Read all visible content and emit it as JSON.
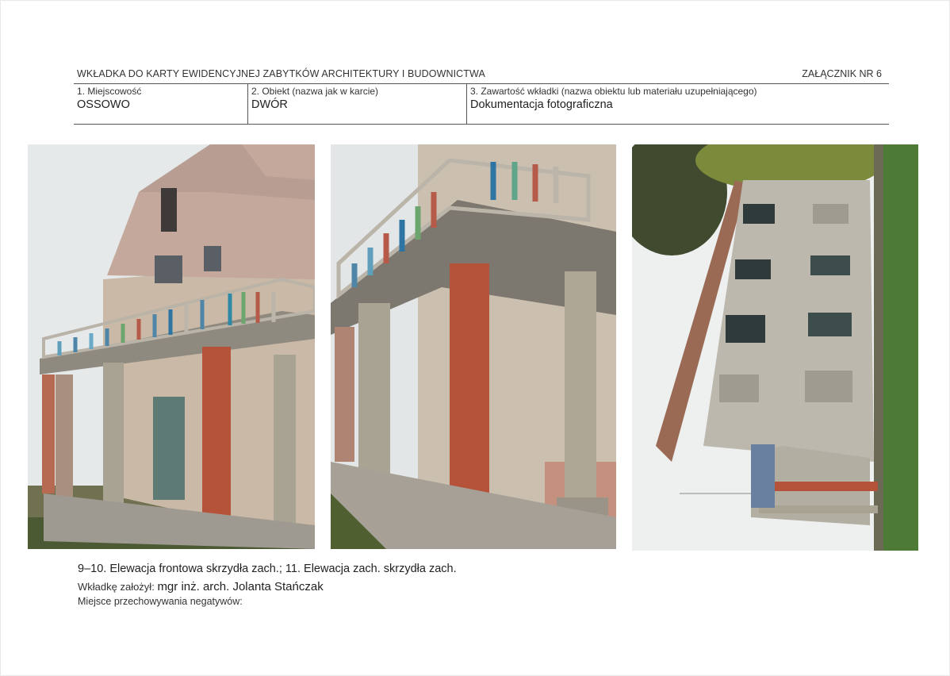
{
  "header": {
    "title": "WKŁADKA DO KARTY EWIDENCYJNEJ ZABYTKÓW ARCHITEKTURY I BUDOWNICTWA",
    "annex": "ZAŁĄCZNIK NR 6"
  },
  "form": {
    "field1": {
      "label": "1. Miejscowość",
      "value": "OSSOWO"
    },
    "field2": {
      "label": "2. Obiekt (nazwa jak w  karcie)",
      "value": "DWÓR"
    },
    "field3": {
      "label": "3. Zawartość wkładki (nazwa obiektu lub materiału uzupełniającego)",
      "value": "Dokumentacja fotograficzna"
    }
  },
  "photos": [
    {
      "subject": "front-elevation-balcony-wide"
    },
    {
      "subject": "front-elevation-balcony-closeup"
    },
    {
      "subject": "west-elevation-rotated"
    }
  ],
  "footer": {
    "caption": "9–10. Elewacja frontowa skrzydła zach.; 11. Elewacja zach. skrzydła zach.",
    "author_label": "Wkładkę założył:",
    "author_name": "mgr inż. arch. Jolanta Stańczak",
    "storage_label": "Miejsce przechowywania negatywów:"
  },
  "colors": {
    "rule": "#555555",
    "text": "#222222",
    "brick": "#b5533a",
    "stucco": "#cdbfae"
  }
}
